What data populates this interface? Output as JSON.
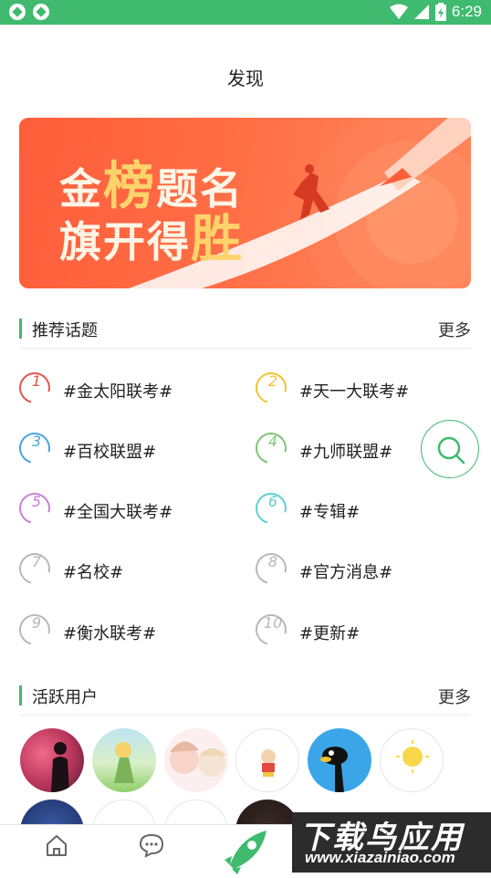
{
  "status_bar": {
    "time": "6:29"
  },
  "page": {
    "title": "发现"
  },
  "banner": {
    "line1_part1": "金",
    "line1_accent": "榜",
    "line1_part2": "题名",
    "line2_part1": "旗开得",
    "line2_accent": "胜"
  },
  "topics_section": {
    "title": "推荐话题",
    "more": "更多",
    "items": [
      {
        "num": "1",
        "label": "#金太阳联考#",
        "color": "#e5534b"
      },
      {
        "num": "2",
        "label": "#天一大联考#",
        "color": "#f2c233"
      },
      {
        "num": "3",
        "label": "#百校联盟#",
        "color": "#4aa3df"
      },
      {
        "num": "4",
        "label": "#九师联盟#",
        "color": "#7cc576"
      },
      {
        "num": "5",
        "label": "#全国大联考#",
        "color": "#c97fd6"
      },
      {
        "num": "6",
        "label": "#专辑#",
        "color": "#5ccfd6"
      },
      {
        "num": "7",
        "label": "#名校#",
        "color": "#b8b8b8"
      },
      {
        "num": "8",
        "label": "#官方消息#",
        "color": "#b8b8b8"
      },
      {
        "num": "9",
        "label": "#衡水联考#",
        "color": "#b8b8b8"
      },
      {
        "num": "10",
        "label": "#更新#",
        "color": "#b8b8b8"
      }
    ]
  },
  "users_section": {
    "title": "活跃用户",
    "more": "更多"
  },
  "watermark": {
    "big": "下载鸟应用",
    "small": "www.xiazainiao.com"
  },
  "colors": {
    "accent": "#3fba6e"
  }
}
